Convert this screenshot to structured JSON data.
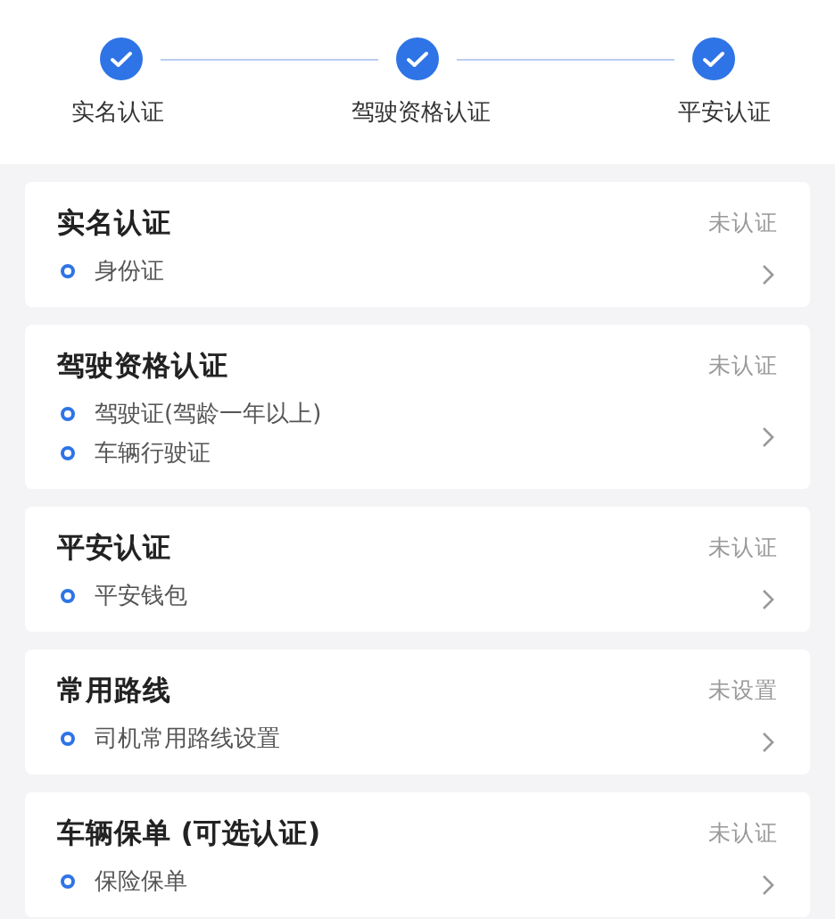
{
  "steps": [
    {
      "label": "实名认证",
      "completed": true
    },
    {
      "label": "驾驶资格认证",
      "completed": true
    },
    {
      "label": "平安认证",
      "completed": true
    }
  ],
  "cards": [
    {
      "title": "实名认证",
      "status": "未认证",
      "items": [
        "身份证"
      ]
    },
    {
      "title": "驾驶资格认证",
      "status": "未认证",
      "items": [
        "驾驶证(驾龄一年以上)",
        "车辆行驶证"
      ]
    },
    {
      "title": "平安认证",
      "status": "未认证",
      "items": [
        "平安钱包"
      ]
    },
    {
      "title": "常用路线",
      "status": "未设置",
      "items": [
        "司机常用路线设置"
      ]
    },
    {
      "title": "车辆保单 (可选认证)",
      "status": "未认证",
      "items": [
        "保险保单"
      ]
    }
  ]
}
